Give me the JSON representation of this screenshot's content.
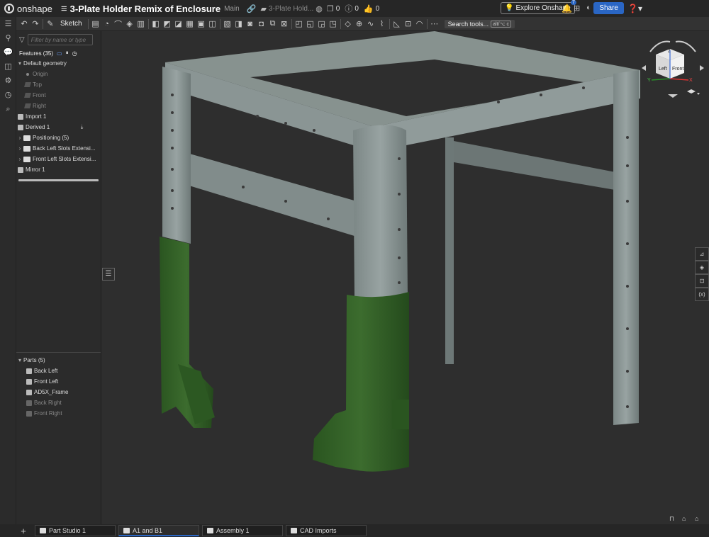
{
  "topbar": {
    "logo": "onshape",
    "doc_title": "3-Plate Holder Remix of Enclosure",
    "branch": "Main",
    "crumb": "3-Plate Hold...",
    "count_a": "0",
    "count_b": "0",
    "count_c": "0",
    "explore": "Explore Onshape",
    "notif_count": "7",
    "share": "Share"
  },
  "toolbar": {
    "sketch": "Sketch",
    "search": "Search tools...",
    "shortcut": "alt/⌥ c"
  },
  "panel": {
    "filter_placeholder": "Filter by name or type",
    "features_label": "Features (35)",
    "tree": [
      {
        "label": "Default geometry"
      },
      {
        "label": "Origin"
      },
      {
        "label": "Top"
      },
      {
        "label": "Front"
      },
      {
        "label": "Right"
      },
      {
        "label": "Import 1"
      },
      {
        "label": "Derived 1"
      },
      {
        "label": "Positioning (5)"
      },
      {
        "label": "Back Left Slots Extensi..."
      },
      {
        "label": "Front Left Slots Extensi..."
      },
      {
        "label": "Mirror 1"
      }
    ],
    "parts_label": "Parts (5)",
    "parts": [
      {
        "label": "Back Left"
      },
      {
        "label": "Front Left"
      },
      {
        "label": "AD5X_Frame"
      },
      {
        "label": "Back Right"
      },
      {
        "label": "Front Right"
      }
    ]
  },
  "viewcube": {
    "left": "Left",
    "front": "Front",
    "axis_y": "Y",
    "axis_x": "X",
    "axis_z": "Z"
  },
  "tabs": [
    {
      "label": "Part Studio 1"
    },
    {
      "label": "A1 and B1"
    },
    {
      "label": "Assembly 1"
    },
    {
      "label": "CAD Imports"
    }
  ],
  "colors": {
    "accent": "#2a66c4",
    "frame": "#7f8a89",
    "green_part": "#2f5a24"
  }
}
